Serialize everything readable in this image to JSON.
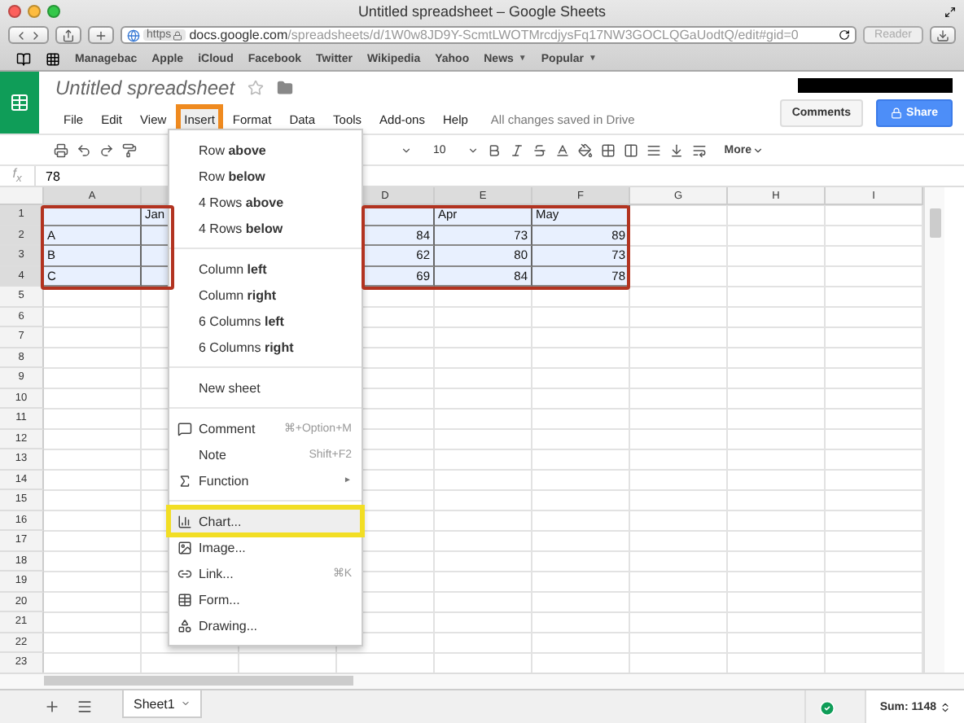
{
  "browser": {
    "title": "Untitled spreadsheet – Google Sheets",
    "scheme": "https",
    "url": {
      "host": "docs.google.com",
      "path": "/spreadsheets/d/1W0w8JD9Y-ScmtLWOTMrcdjysFq17NW3GOCLQGaUodtQ/edit#gid=0"
    },
    "reader": "Reader",
    "bookmarks": [
      {
        "label": "Managebac"
      },
      {
        "label": "Apple"
      },
      {
        "label": "iCloud"
      },
      {
        "label": "Facebook"
      },
      {
        "label": "Twitter"
      },
      {
        "label": "Wikipedia"
      },
      {
        "label": "Yahoo"
      },
      {
        "label": "News",
        "caret": "▼"
      },
      {
        "label": "Popular",
        "caret": "▼"
      }
    ]
  },
  "app": {
    "doc_title": "Untitled spreadsheet",
    "save_status": "All changes saved in Drive",
    "comments": "Comments",
    "share": "Share",
    "menu": [
      {
        "label": "File",
        "selected": false,
        "callout": false
      },
      {
        "label": "Edit",
        "selected": false,
        "callout": false
      },
      {
        "label": "View",
        "selected": false,
        "callout": false
      },
      {
        "label": "Insert",
        "selected": true,
        "callout": true
      },
      {
        "label": "Format",
        "selected": false,
        "callout": false
      },
      {
        "label": "Data",
        "selected": false,
        "callout": false
      },
      {
        "label": "Tools",
        "selected": false,
        "callout": false
      },
      {
        "label": "Add-ons",
        "selected": false,
        "callout": false
      },
      {
        "label": "Help",
        "selected": false,
        "callout": false
      }
    ]
  },
  "toolbar": {
    "font_size": "10",
    "more": "More"
  },
  "formula": {
    "label": "f$_{x}$",
    "value": "78"
  },
  "columns": [
    {
      "label": "A",
      "selected": true
    },
    {
      "selected": true
    },
    null,
    {
      "label": "D",
      "selected": true
    },
    {
      "label": "E",
      "selected": true
    },
    {
      "label": "F",
      "selected": true
    },
    {
      "label": "G",
      "selected": false
    },
    {
      "label": "H",
      "selected": false
    },
    {
      "label": "I",
      "selected": false
    }
  ],
  "rows": [
    {
      "number": "1",
      "selected": true,
      "cells": [
        null,
        "Jan",
        null,
        null,
        "Apr",
        "May"
      ]
    },
    {
      "number": "2",
      "selected": true,
      "cells": [
        "A",
        null,
        null,
        "84",
        "73",
        "89"
      ]
    },
    {
      "number": "3",
      "selected": true,
      "cells": [
        "B",
        null,
        null,
        "62",
        "80",
        "73"
      ]
    },
    {
      "number": "4",
      "selected": true,
      "cells": [
        "C",
        null,
        null,
        "69",
        "84",
        "78"
      ]
    },
    {
      "number": "5",
      "selected": false
    },
    {
      "number": "6",
      "selected": false
    },
    {
      "number": "7",
      "selected": false
    },
    {
      "number": "8",
      "selected": false
    },
    {
      "number": "9",
      "selected": false
    },
    {
      "number": "10",
      "selected": false
    },
    {
      "number": "11",
      "selected": false
    },
    {
      "number": "12",
      "selected": false
    },
    {
      "number": "13",
      "selected": false
    },
    {
      "number": "14",
      "selected": false
    },
    {
      "number": "15",
      "selected": false
    },
    {
      "number": "16",
      "selected": false
    },
    {
      "number": "17",
      "selected": false
    },
    {
      "number": "18",
      "selected": false
    },
    {
      "number": "19",
      "selected": false
    },
    {
      "number": "20",
      "selected": false
    },
    {
      "number": "21",
      "selected": false
    },
    {
      "number": "22",
      "selected": false
    },
    {
      "number": "23",
      "selected": false
    }
  ],
  "range_callouts": [
    {
      "color": "#b23320"
    },
    {
      "color": "#b23320"
    }
  ],
  "insert_menu": [
    {
      "kind": "item",
      "label": "Row **above**"
    },
    {
      "kind": "item",
      "label": "Row **below**"
    },
    {
      "kind": "item",
      "label": "4 Rows **above**"
    },
    {
      "kind": "item",
      "label": "4 Rows **below**"
    },
    {
      "kind": "separator"
    },
    {
      "kind": "item",
      "label": "Column **left**"
    },
    {
      "kind": "item",
      "label": "Column **right**"
    },
    {
      "kind": "item",
      "label": "6 Columns **left**"
    },
    {
      "kind": "item",
      "label": "6 Columns **right**"
    },
    {
      "kind": "separator"
    },
    {
      "kind": "item",
      "label": "New sheet"
    },
    {
      "kind": "separator"
    },
    {
      "kind": "comment",
      "label": "Comment",
      "shortcut": "⌘+Option+M"
    },
    {
      "kind": "item",
      "label": "Note",
      "shortcut": "Shift+F2"
    },
    {
      "kind": "function",
      "label": "Function",
      "submenu": "►"
    },
    {
      "kind": "separator"
    },
    {
      "kind": "chart",
      "label": "Chart...",
      "highlighted": true,
      "callout": true
    },
    {
      "kind": "image",
      "label": "Image..."
    },
    {
      "kind": "link",
      "label": "Link...",
      "shortcut": "⌘K"
    },
    {
      "kind": "form",
      "label": "Form..."
    },
    {
      "kind": "drawing",
      "label": "Drawing..."
    }
  ],
  "sheets": [
    {
      "label": "Sheet1",
      "selected": true
    }
  ],
  "status": {
    "sum": "Sum: 1148"
  }
}
